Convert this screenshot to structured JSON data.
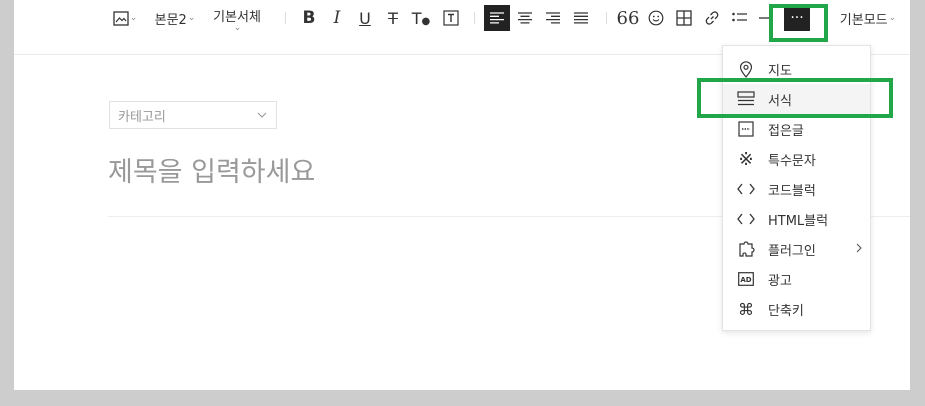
{
  "toolbar": {
    "paragraph_style": "본문2",
    "font": "기본서체",
    "mode": "기본모드",
    "more_label": "···"
  },
  "category": {
    "label": "카테고리"
  },
  "editor": {
    "title_placeholder": "제목을 입력하세요"
  },
  "more_menu": {
    "items": [
      {
        "label": "지도",
        "icon": "map-pin-icon"
      },
      {
        "label": "서식",
        "icon": "template-icon"
      },
      {
        "label": "접은글",
        "icon": "fold-text-icon"
      },
      {
        "label": "특수문자",
        "icon": "special-char-icon"
      },
      {
        "label": "코드블럭",
        "icon": "code-icon"
      },
      {
        "label": "HTML블럭",
        "icon": "html-icon"
      },
      {
        "label": "플러그인",
        "icon": "plugin-icon"
      },
      {
        "label": "광고",
        "icon": "ad-icon"
      },
      {
        "label": "단축키",
        "icon": "command-icon"
      }
    ]
  },
  "colors": {
    "highlight": "#22a64a",
    "active_button": "#222222"
  }
}
